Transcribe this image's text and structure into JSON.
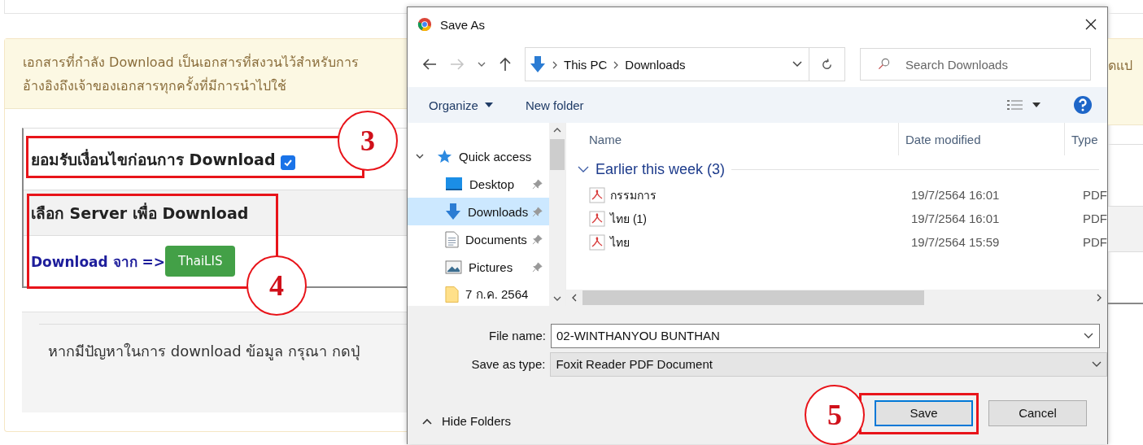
{
  "notice": {
    "line_1": "เอกสารที่กำลัง Download เป็นเอกสารที่สงวนไว้สำหรับการ",
    "line_1_end": "ดแป",
    "line_2": "อ้างอิงถึงเจ้าของเอกสารทุกครั้งที่มีการนำไปใช้"
  },
  "accept_row": {
    "label": "ยอมรับเงื่อนไขก่อนการ Download",
    "checked": true
  },
  "server_header": "เลือก Server เพื่อ Download",
  "download_from": {
    "label": "Download จาก =>",
    "button": "ThaiLIS"
  },
  "help_text": "หากมีปัญหาในการ download ข้อมูล กรุณา กดปุ่",
  "callouts": [
    {
      "number": "3"
    },
    {
      "number": "4"
    },
    {
      "number": "5"
    }
  ],
  "dialog": {
    "title": "Save As",
    "path": [
      "This PC",
      "Downloads"
    ],
    "search_placeholder": "Search Downloads",
    "toolbar": {
      "organize": "Organize",
      "new_folder": "New folder"
    },
    "nav": [
      {
        "label": "Quick access",
        "kind": "quick",
        "pinned": false,
        "selected": false
      },
      {
        "label": "Desktop",
        "kind": "desktop",
        "pinned": true,
        "selected": false
      },
      {
        "label": "Downloads",
        "kind": "downloads",
        "pinned": true,
        "selected": true
      },
      {
        "label": "Documents",
        "kind": "documents",
        "pinned": true,
        "selected": false
      },
      {
        "label": "Pictures",
        "kind": "pictures",
        "pinned": true,
        "selected": false
      },
      {
        "label": "7 ก.ค. 2564",
        "kind": "folder",
        "pinned": false,
        "selected": false
      }
    ],
    "columns": [
      "Name",
      "Date modified",
      "Type"
    ],
    "group": "Earlier this week (3)",
    "files": [
      {
        "name": "กรรมการ",
        "date": "19/7/2564 16:01",
        "type": "PDF"
      },
      {
        "name": "ไทย (1)",
        "date": "19/7/2564 16:01",
        "type": "PDF"
      },
      {
        "name": "ไทย",
        "date": "19/7/2564 15:59",
        "type": "PDF"
      }
    ],
    "file_name_label": "File name:",
    "file_name": "02-WINTHANYOU BUNTHAN",
    "save_type_label": "Save as type:",
    "save_type": "Foxit Reader PDF Document",
    "hide_folders": "Hide Folders",
    "save": "Save",
    "cancel": "Cancel"
  }
}
